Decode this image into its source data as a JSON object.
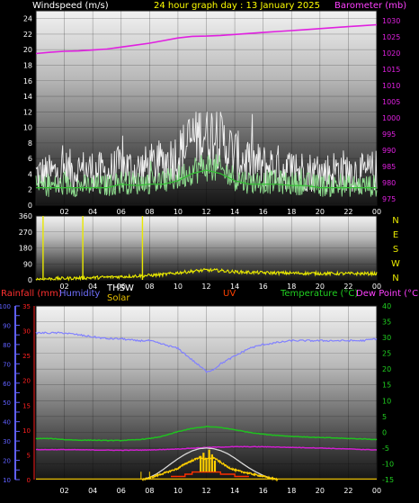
{
  "header": {
    "windspeed_label": "Windspeed (m/s)",
    "title": "24 hour graph day : 13 January 2025",
    "barometer_label": "Barometer (mb)"
  },
  "panel3_labels": {
    "rainfall": "Rainfall (mm)",
    "humidity": "Humidity",
    "thsw": "THSW",
    "solar": "Solar",
    "uv": "UV",
    "temperature": "Temperature (°C)",
    "dewpoint": "Dew Point (°C)"
  },
  "colors": {
    "background": "#000000",
    "panel_top": "#e8e8e8",
    "panel_bottom": "#1a1a1a",
    "wind_gust": "#f0f0f0",
    "wind_speed": "#90e090",
    "wind_avg": "#30c030",
    "barometer": "#e020e0",
    "wind_direction": "#e8e800",
    "humidity": "#8080ff",
    "temperature": "#20c020",
    "dewpoint": "#d020d0",
    "solar": "#d8d8d8",
    "thsw": "#ffd000",
    "uv": "#ff3000",
    "rainfall": "#ff2020",
    "axis_left": "#ffffff",
    "axis_right_green": "#20d020",
    "axis_humidity": "#6060ff"
  },
  "chart_data": [
    {
      "type": "line",
      "id": "wind",
      "x_ticks": [
        "02",
        "04",
        "06",
        "08",
        "10",
        "12",
        "14",
        "16",
        "18",
        "20",
        "22",
        "00"
      ],
      "x_range_hours": [
        0,
        24
      ],
      "left_axis": {
        "label": "Windspeed (m/s)",
        "ylim": [
          0,
          25
        ],
        "ticks": [
          0,
          2,
          4,
          6,
          8,
          10,
          12,
          14,
          16,
          18,
          20,
          22,
          24
        ]
      },
      "right_axis": {
        "label": "Barometer (mb)",
        "ylim": [
          973,
          1033
        ],
        "ticks": [
          975,
          980,
          985,
          990,
          995,
          1000,
          1005,
          1010,
          1015,
          1020,
          1025,
          1030
        ]
      },
      "barometer": {
        "x": [
          0,
          1,
          2,
          3,
          4,
          5,
          6,
          7,
          8,
          9,
          10,
          11,
          12,
          13,
          14,
          15,
          16,
          17,
          18,
          19,
          20,
          21,
          22,
          23,
          24
        ],
        "y": [
          1019.8,
          1020.2,
          1020.5,
          1020.6,
          1020.9,
          1021.2,
          1021.8,
          1022.4,
          1023.0,
          1023.8,
          1024.6,
          1025.1,
          1025.2,
          1025.4,
          1025.7,
          1026.0,
          1026.3,
          1026.6,
          1026.9,
          1027.2,
          1027.5,
          1027.8,
          1028.1,
          1028.4,
          1028.7
        ]
      },
      "gust_envelope": {
        "x": [
          0,
          1,
          2,
          3,
          4,
          5,
          6,
          7,
          8,
          9,
          10,
          11,
          12,
          13,
          14,
          15,
          16,
          17,
          18,
          19,
          20,
          21,
          22,
          23,
          24
        ],
        "y": [
          4.0,
          4.0,
          4.5,
          4.5,
          4.5,
          4.0,
          5.0,
          4.5,
          5.0,
          5.5,
          6.5,
          8.5,
          9.5,
          8.5,
          6.5,
          5.5,
          5.0,
          5.0,
          4.5,
          4.5,
          4.0,
          4.5,
          4.5,
          4.0,
          4.5
        ],
        "max": 12
      },
      "speed_envelope": {
        "x": [
          0,
          1,
          2,
          3,
          4,
          5,
          6,
          7,
          8,
          9,
          10,
          11,
          12,
          13,
          14,
          15,
          16,
          17,
          18,
          19,
          20,
          21,
          22,
          23,
          24
        ],
        "y": [
          2.5,
          2.5,
          2.5,
          2.5,
          2.5,
          2.5,
          3.0,
          2.8,
          3.0,
          3.0,
          3.5,
          4.5,
          5.0,
          4.5,
          3.5,
          3.0,
          3.0,
          3.0,
          2.8,
          2.8,
          2.5,
          2.5,
          2.5,
          2.5,
          2.5
        ],
        "max": 8
      }
    },
    {
      "type": "scatter",
      "id": "wind_direction",
      "ylim": [
        0,
        360
      ],
      "left_ticks": [
        0,
        90,
        180,
        270,
        360
      ],
      "right_ticks": [
        "N",
        "W",
        "S",
        "E",
        "N"
      ],
      "baseline": {
        "x": [
          0,
          2,
          4,
          6,
          8,
          9,
          10,
          11,
          12,
          13,
          14,
          16,
          18,
          20,
          22,
          24
        ],
        "y": [
          4,
          8,
          12,
          18,
          25,
          30,
          40,
          48,
          55,
          52,
          45,
          40,
          38,
          36,
          35,
          35
        ]
      },
      "spikes_hours": [
        0.5,
        3.3,
        7.5
      ]
    },
    {
      "type": "line",
      "id": "temperature_panel",
      "left_axis_humidity": {
        "ylim": [
          10,
          100
        ],
        "ticks": [
          10,
          15,
          20,
          25,
          30,
          35,
          40,
          45,
          50,
          55,
          60,
          65,
          70,
          75,
          80,
          85,
          90,
          95,
          100
        ]
      },
      "left_axis_rainfall": {
        "ylim": [
          0,
          35
        ],
        "ticks": [
          0,
          5,
          10,
          15,
          20,
          25,
          30,
          35
        ]
      },
      "right_axis_temperature": {
        "ylim": [
          -15,
          40
        ],
        "ticks": [
          -15,
          -10,
          -5,
          0,
          5,
          10,
          15,
          20,
          25,
          30,
          35,
          40
        ]
      },
      "humidity": {
        "x": [
          0,
          1,
          2,
          3,
          4,
          5,
          6,
          7,
          8,
          9,
          10,
          11,
          11.5,
          12,
          12.5,
          13,
          14,
          15,
          16,
          17,
          18,
          19,
          20,
          21,
          22,
          23,
          24
        ],
        "y": [
          86,
          86,
          86,
          85,
          84,
          83,
          83,
          82,
          82,
          80,
          78,
          72,
          69,
          66,
          67,
          70,
          74,
          78,
          80,
          81,
          82,
          82,
          82,
          82,
          82,
          82,
          83
        ]
      },
      "temperature": {
        "x": [
          0,
          1,
          2,
          3,
          4,
          5,
          6,
          7,
          8,
          9,
          10,
          11,
          12,
          13,
          14,
          15,
          16,
          17,
          18,
          19,
          20,
          21,
          22,
          23,
          24
        ],
        "y": [
          -2.0,
          -2.0,
          -2.3,
          -2.5,
          -2.5,
          -2.6,
          -2.6,
          -2.4,
          -2.0,
          -1.2,
          0.2,
          1.2,
          1.8,
          1.5,
          0.8,
          0,
          -0.6,
          -1.0,
          -1.3,
          -1.5,
          -1.7,
          -1.8,
          -2.0,
          -2.1,
          -2.3
        ]
      },
      "dewpoint": {
        "x": [
          0,
          2,
          4,
          6,
          8,
          10,
          12,
          14,
          16,
          18,
          20,
          22,
          24
        ],
        "y": [
          -5.5,
          -5.5,
          -5.6,
          -5.7,
          -5.6,
          -5.3,
          -4.8,
          -4.6,
          -4.6,
          -4.8,
          -5.0,
          -5.3,
          -5.6
        ]
      },
      "solar": {
        "x": [
          7.5,
          8,
          8.5,
          9,
          9.5,
          10,
          10.5,
          11,
          11.5,
          12,
          12.5,
          13,
          13.5,
          14,
          14.5,
          15,
          15.5,
          16,
          16.5,
          17
        ],
        "y": [
          -15,
          -14.3,
          -13.2,
          -11.7,
          -10.0,
          -8.4,
          -7.0,
          -5.9,
          -5.2,
          -5.0,
          -5.2,
          -5.8,
          -6.8,
          -8.2,
          -9.8,
          -11.3,
          -12.6,
          -13.7,
          -14.5,
          -15
        ]
      },
      "thsw_bars": {
        "x": [
          11.6,
          11.8,
          12.0,
          12.2,
          12.4,
          12.6
        ],
        "y": [
          -7.5,
          -6.5,
          -8.5,
          -5.5,
          -7.0,
          -9.0
        ]
      },
      "thsw": {
        "x": [
          7.5,
          8,
          9,
          10,
          10.5,
          11,
          11.5,
          12,
          12.5,
          13,
          13.5,
          14,
          14.5,
          15,
          16,
          16.5,
          17
        ],
        "y": [
          -15,
          -14.5,
          -13.0,
          -11.5,
          -10.0,
          -9.0,
          -8.0,
          -8.5,
          -8.0,
          -9.5,
          -11.0,
          -12.0,
          -12.5,
          -13.0,
          -14.0,
          -14.5,
          -15
        ]
      },
      "uv_steps": {
        "x": [
          9.5,
          10.5,
          10.5,
          11.0,
          11.0,
          13.0,
          13.0,
          14.0,
          14.0,
          15.0
        ],
        "y": [
          -14.0,
          -14.0,
          -13.3,
          -13.3,
          -12.6,
          -12.6,
          -13.3,
          -13.3,
          -14.0,
          -14.0
        ]
      },
      "rain": []
    }
  ]
}
